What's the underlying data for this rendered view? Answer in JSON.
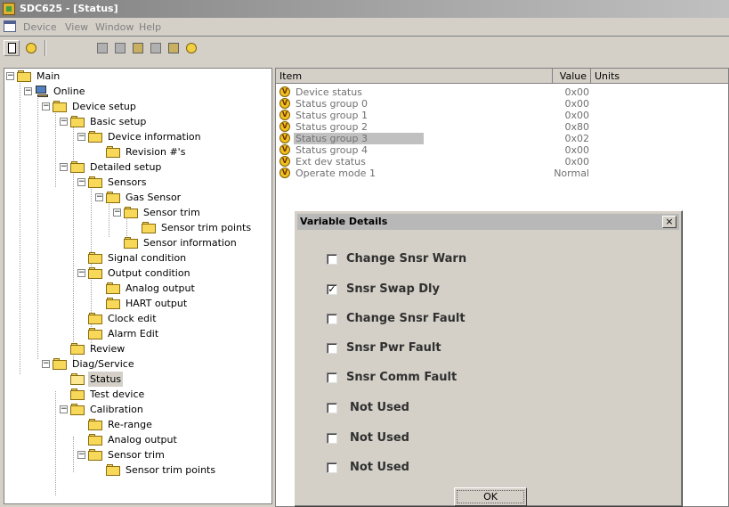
{
  "window": {
    "title": "SDC625 - [Status]"
  },
  "menu": {
    "items": [
      "Device",
      "View",
      "Window",
      "Help"
    ]
  },
  "toolbar": {
    "buttons": [
      "new-icon",
      "help-icon",
      "tool-a-icon",
      "tool-b-icon",
      "tool-c-icon",
      "tool-d-icon",
      "tool-e-icon",
      "tool-f-icon"
    ]
  },
  "tree": {
    "nodes": [
      {
        "label": "Main"
      },
      {
        "label": "Online"
      },
      {
        "label": "Device setup"
      },
      {
        "label": "Basic setup"
      },
      {
        "label": "Device information"
      },
      {
        "label": "Revision #'s"
      },
      {
        "label": "Detailed setup"
      },
      {
        "label": "Sensors"
      },
      {
        "label": "Gas Sensor"
      },
      {
        "label": "Sensor trim"
      },
      {
        "label": "Sensor trim points"
      },
      {
        "label": "Sensor information"
      },
      {
        "label": "Signal condition"
      },
      {
        "label": "Output condition"
      },
      {
        "label": "Analog output"
      },
      {
        "label": "HART output"
      },
      {
        "label": "Clock edit"
      },
      {
        "label": "Alarm Edit"
      },
      {
        "label": "Review"
      },
      {
        "label": "Diag/Service"
      },
      {
        "label": "Status"
      },
      {
        "label": "Test device"
      },
      {
        "label": "Calibration"
      },
      {
        "label": "Re-range"
      },
      {
        "label": "Analog output"
      },
      {
        "label": "Sensor trim"
      },
      {
        "label": "Sensor trim points"
      }
    ]
  },
  "list": {
    "columns": [
      "Item",
      "Value",
      "Units"
    ],
    "rows": [
      {
        "item": "Device status",
        "value": "0x00"
      },
      {
        "item": "Status group 0",
        "value": "0x00"
      },
      {
        "item": "Status group 1",
        "value": "0x00"
      },
      {
        "item": "Status group 2",
        "value": "0x80"
      },
      {
        "item": "Status group 3",
        "value": "0x02"
      },
      {
        "item": "Status group 4",
        "value": "0x00"
      },
      {
        "item": "Ext dev status",
        "value": "0x00"
      },
      {
        "item": "Operate mode 1",
        "value": "Normal"
      }
    ],
    "icon_letter": "V"
  },
  "dialog": {
    "title": "Variable Details",
    "close_glyph": "×",
    "checkboxes": [
      {
        "label": "Change Snsr Warn",
        "checked": false
      },
      {
        "label": "Snsr Swap Dly",
        "checked": true
      },
      {
        "label": "Change Snsr Fault",
        "checked": false
      },
      {
        "label": "Snsr Pwr Fault",
        "checked": false
      },
      {
        "label": "Snsr Comm Fault",
        "checked": false
      },
      {
        "label": "Not Used",
        "checked": false
      },
      {
        "label": "Not Used",
        "checked": false
      },
      {
        "label": "Not Used",
        "checked": false
      }
    ],
    "check_glyph": "✓",
    "ok_label": "OK"
  }
}
